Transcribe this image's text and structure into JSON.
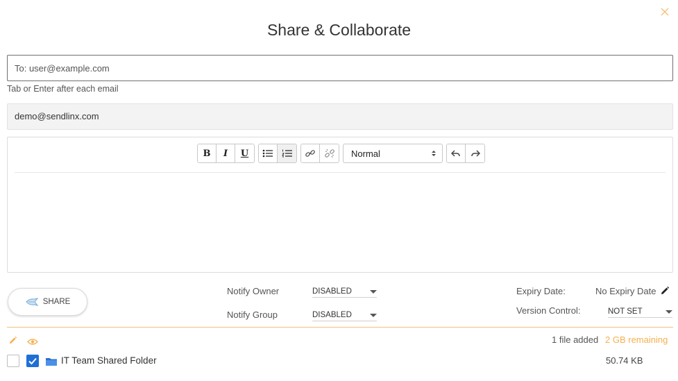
{
  "dialog": {
    "title": "Share & Collaborate"
  },
  "recipients": {
    "placeholder": "To: user@example.com",
    "value": "",
    "hint": "Tab or Enter after each email"
  },
  "sender": {
    "email": "demo@sendlinx.com"
  },
  "editor": {
    "toolbar": {
      "bold": "B",
      "italic": "I",
      "underline": "U",
      "format_value": "Normal"
    },
    "body": ""
  },
  "actions": {
    "share_label": "SHARE"
  },
  "notify": {
    "owner_label": "Notify Owner",
    "owner_value": "DISABLED",
    "group_label": "Notify Group",
    "group_value": "DISABLED"
  },
  "settings": {
    "expiry_label": "Expiry Date:",
    "expiry_value": "No Expiry Date",
    "version_label": "Version Control:",
    "version_value": "NOT SET"
  },
  "file_summary": {
    "count_text": "1 file added",
    "remaining_text": "2 GB remaining"
  },
  "files": [
    {
      "name": "IT Team Shared Folder",
      "size": "50.74 KB",
      "selected": true
    }
  ],
  "colors": {
    "accent": "#f5b04f",
    "checkbox": "#1f6fd6",
    "folder": "#3f8ae0"
  }
}
